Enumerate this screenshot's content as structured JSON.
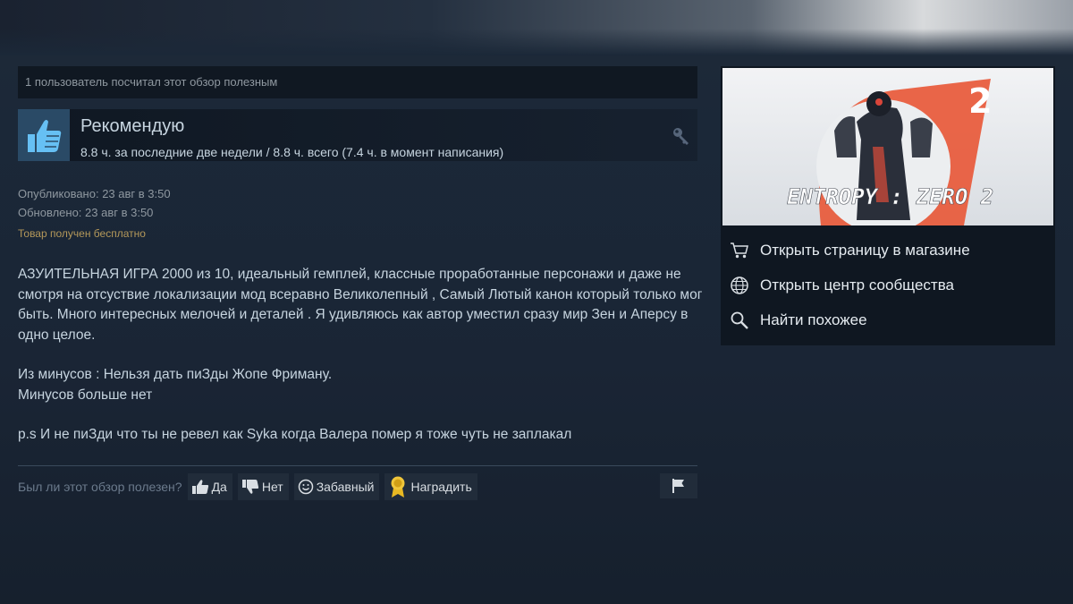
{
  "review": {
    "helpful_count_text": "1 пользователь посчитал этот обзор полезным",
    "recommendation": "Рекомендую",
    "hours": "8.8 ч. за последние две недели / 8.8 ч. всего (7.4 ч. в момент написания)",
    "published": "Опубликовано: 23 авг в 3:50",
    "updated": "Обновлено: 23 авг в 3:50",
    "received_free": "Товар получен бесплатно",
    "text": {
      "p1": "АЗУИТЕЛЬНАЯ ИГРА 2000 из 10, идеальный гемплей, классные проработанные персонажи и даже не смотря на отсуствие локализации мод всеравно Великолепный , Самый Лютый канон который только мог быть. Много интересных мелочей и деталей . Я удивляюсь как автор уместил сразу мир Зен и Аперсу в одно целое.",
      "p2_line1": "Из минусов : Нельзя дать пиЗды Жопе Фриману.",
      "p2_line2": "Минусов больше нет",
      "p3": "p.s И не пиЗди что ты не ревел как Syka когда Валера помер я тоже чуть не заплакал"
    }
  },
  "voting": {
    "question": "Был ли этот обзор полезен?",
    "yes": "Да",
    "no": "Нет",
    "funny": "Забавный",
    "award": "Наградить"
  },
  "game": {
    "art_title": "ENTROPY : ZERO 2",
    "art_number": "2",
    "links": {
      "store": "Открыть страницу в магазине",
      "community": "Открыть центр сообщества",
      "similar": "Найти похожее"
    }
  },
  "colors": {
    "background": "#1b2838",
    "accent_orange": "#e8593a",
    "free_label": "#b4985a",
    "thumb_blue": "#66c0f4"
  },
  "icons": [
    "thumb-up-icon",
    "key-icon",
    "thumb-down-icon",
    "smiley-icon",
    "award-icon",
    "flag-icon",
    "cart-icon",
    "globe-icon",
    "search-icon"
  ]
}
